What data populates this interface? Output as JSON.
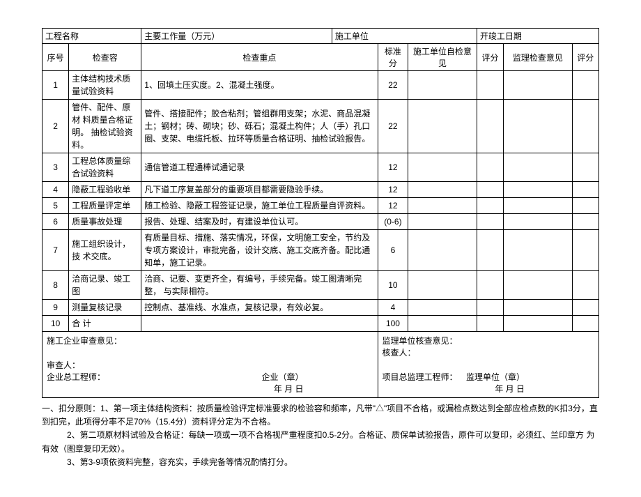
{
  "header": {
    "projectNameLabel": "工程名称",
    "mainWorkloadLabel": "主要工作量（万元）",
    "constructionUnitLabel": "施工单位",
    "startCompleteDateLabel": "开竣工日期"
  },
  "columns": {
    "seq": "序号",
    "inspectContent": "检查容",
    "inspectKey": "检查重点",
    "stdScore": "标准分",
    "selfOpinion": "施工单位自检意见",
    "score1": "评分",
    "supervisorOpinion": "监理检查意见",
    "score2": "评分"
  },
  "rows": [
    {
      "seq": "1",
      "content": "主体结构技术质  量试验资料",
      "key": "1、回填土压实度。2、混凝土强度。",
      "std": "22"
    },
    {
      "seq": "2",
      "content": "管件、配件、原材 料质量合格证明。 抽检试验资料。",
      "key": "管件、搭接配件；胶合粘剂；管组群用支架；水泥、商品混凝  土；钢材；砖、砌块；砂、砾石；混凝土构件；人（手）孔口  圈、支架、电缆托板、拉环等质量合格证明、抽检试验报告。",
      "std": "22"
    },
    {
      "seq": "3",
      "content": "工程总体质量综  合试验资料",
      "key": "通信管道工程通棒试通记录",
      "std": "12"
    },
    {
      "seq": "4",
      "content": "隐蔽工程验收单",
      "key": "凡下道工序复盖部分的重要项目都需要隐验手续。",
      "std": "12"
    },
    {
      "seq": "5",
      "content": "工程质量评定单",
      "key": "随工检验、隐蔽工程签证记录，施工单位工程质量自评资料。",
      "std": "12"
    },
    {
      "seq": "6",
      "content": "质量事故处理",
      "key": "报告、处理、结案及时，有建设单位认可。",
      "std": "(0-6)"
    },
    {
      "seq": "7",
      "content": "施工组织设计，技 术交底。",
      "key": "有质量目标、措施、落实情况，环保，文明施工安全，节约及  专项方案设计，审批完备，设计交底、施工交底齐备。配比通  知单，施工记录。",
      "std": "6"
    },
    {
      "seq": "8",
      "content": "洽商记录、竣工图",
      "key": "洽商、记要、变更齐全，有编号，手续完备。竣工图清晰完整，  与实际相符。",
      "std": "10"
    },
    {
      "seq": "9",
      "content": "测量复核记录",
      "key": "控制点、基准线、水准点，复核记录，有效必复。",
      "std": "4"
    },
    {
      "seq": "10",
      "content": "合         计",
      "key": "",
      "std": "100"
    }
  ],
  "footer": {
    "leftTitle": "施工企业审查意见：",
    "leftReviewer": "审查人：",
    "leftEngineer": "企业总工程师：",
    "leftSeal": "企业（章）",
    "rightTitle": "监理单位核查意见：",
    "rightReviewer": "核查人：",
    "rightEngineer": "项目总监理工程师：",
    "rightSeal": "监理单位（章）",
    "dateFormat": "年 月 日"
  },
  "notes": {
    "prefix": "一、扣分原则：",
    "n1": "1、第一项主体结构资料：按质量检验评定标准要求的检验容和频率，凡带\"△\"项目不合格，或漏检点数达到全部应检点数的K扣3分，直  到扣完，此项得分率不足70%（15.4分）资料评分定为不合格。",
    "n2": "2、第二项原材料试验及合格证：每缺一项或一项不合格视严重程度扣0.5-2分。合格证、质保单试验报告，原件可以复印，必须红、兰印章方  为有效（图章复印无效）。",
    "n3": "3、第3-9项依资料完整，容充实，手续完备等情况酌情打分。"
  }
}
